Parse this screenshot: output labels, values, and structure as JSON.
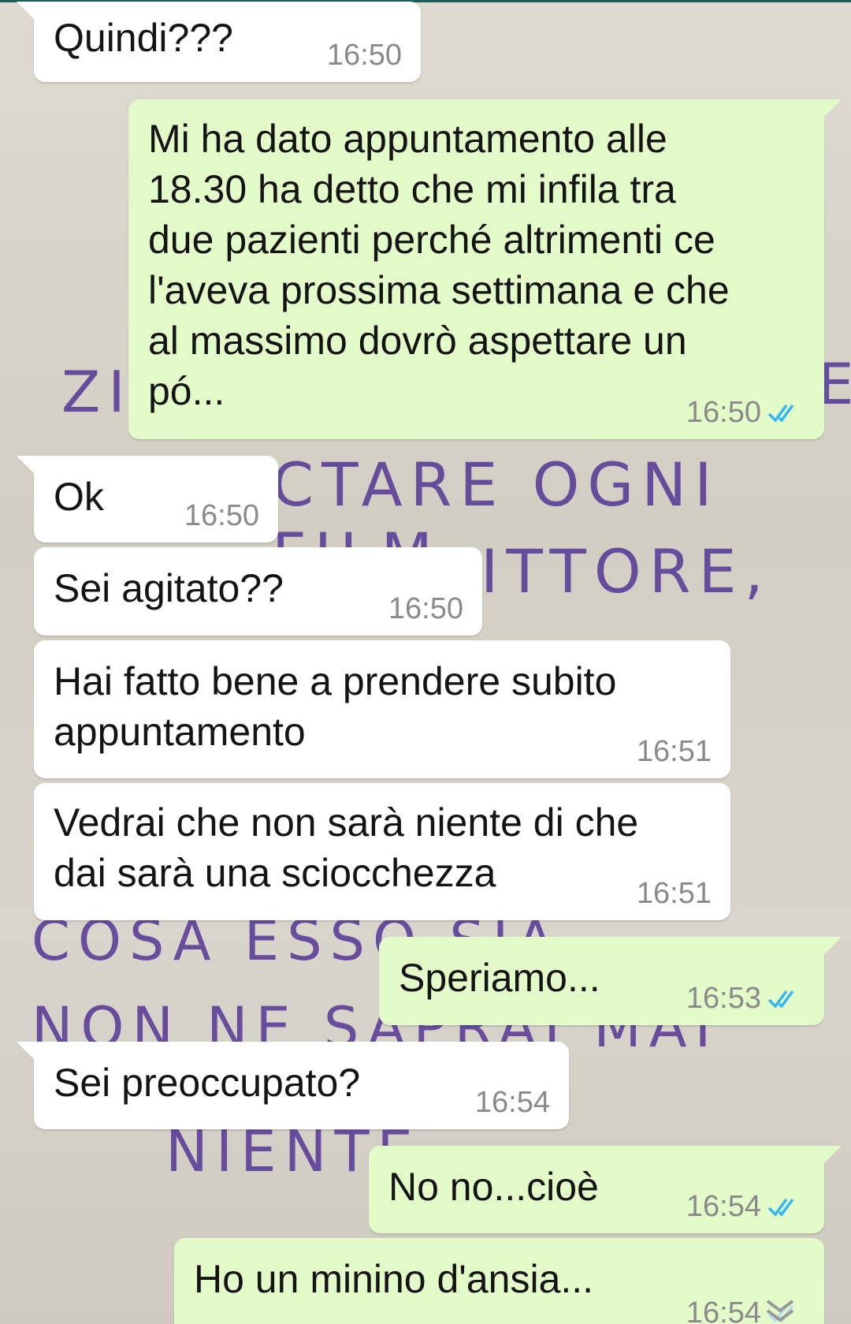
{
  "colors": {
    "incoming_bubble": "#ffffff",
    "outgoing_bubble": "#e2fbc8",
    "timestamp": "#8a8a8a",
    "read_ticks": "#34b7f1",
    "wall_writing": "#5b3f98"
  },
  "background_writing": {
    "line1_left": "ZI",
    "line1_right": "E",
    "line2": "CTARE OGNI FILM,",
    "line3": "ITTORE,",
    "line4": "COSA ESSO SIA",
    "line5": "NON NE SAPRAI MAI",
    "line6": "NIENTE"
  },
  "messages": [
    {
      "dir": "in",
      "text": "Quindi???",
      "time": "16:50"
    },
    {
      "dir": "out",
      "text": "Mi ha dato appuntamento alle\n18.30 ha detto che mi infila tra\ndue pazienti perché altrimenti ce\nl'aveva prossima settimana e che\nal massimo dovrò aspettare un\npó...",
      "time": "16:50",
      "status": "read"
    },
    {
      "dir": "in",
      "text": "Ok",
      "time": "16:50"
    },
    {
      "dir": "in",
      "text": "Sei agitato??",
      "time": "16:50"
    },
    {
      "dir": "in",
      "text": "Hai fatto bene a prendere subito\nappuntamento",
      "time": "16:51"
    },
    {
      "dir": "in",
      "text": "Vedrai che non sarà niente di che\ndai sarà una sciocchezza",
      "time": "16:51"
    },
    {
      "dir": "out",
      "text": "Speriamo...",
      "time": "16:53",
      "status": "read"
    },
    {
      "dir": "in",
      "text": "Sei preoccupato?",
      "time": "16:54"
    },
    {
      "dir": "out",
      "text": "No no...cioè",
      "time": "16:54",
      "status": "read"
    },
    {
      "dir": "out",
      "text": "Ho un minino d'ansia...",
      "time": "16:54",
      "status": "read"
    }
  ],
  "icons": {
    "read_receipt": "double-check-icon",
    "scroll": "chevron-down-icon"
  }
}
